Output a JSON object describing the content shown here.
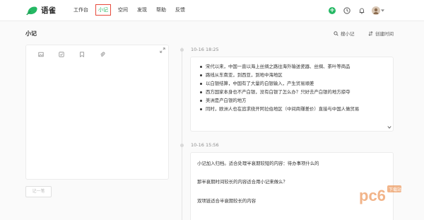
{
  "app": {
    "name": "语雀"
  },
  "nav": {
    "items": [
      "工作台",
      "小记",
      "空间",
      "发现",
      "帮助",
      "反馈"
    ],
    "active": 1
  },
  "page": {
    "title": "小记",
    "search_label": "搜小记",
    "sort_label": "创建时间"
  },
  "editor": {
    "submit_label": "记一笔"
  },
  "notes": [
    {
      "time": "10-16 18:25",
      "items": [
        "宋代以来，中国一直以海上丝绸之路往海外输送瓷器、丝绸、茶叶等商品",
        "路线从东南亚，到西亚，到地中海地区",
        "以白银结算，中国有了大量的白银输入，产生贸易顺差",
        "西方国家本身也不产白银，没有白银了怎么办？只好去产白银的地方掠夺",
        "美洲是产白银的地方",
        "同时，欧洲人也在追求绕开阿拉伯地区（中间商赚差价）直接与中国人做贸易"
      ]
    },
    {
      "time": "10-16 15:56",
      "lines": [
        "小记加入归档。适合处理半衰期较短的内容：待办事项什么的",
        "那半衰期时间较长的内容适合用小记来做么？",
        "双项链适合半衰期较长的内容"
      ]
    }
  ],
  "watermark": {
    "text": "pc6",
    "sub": "下载站"
  },
  "colors": {
    "brand": "#25b864",
    "highlight": "#e64a3c",
    "watermark": "#e8782a"
  }
}
